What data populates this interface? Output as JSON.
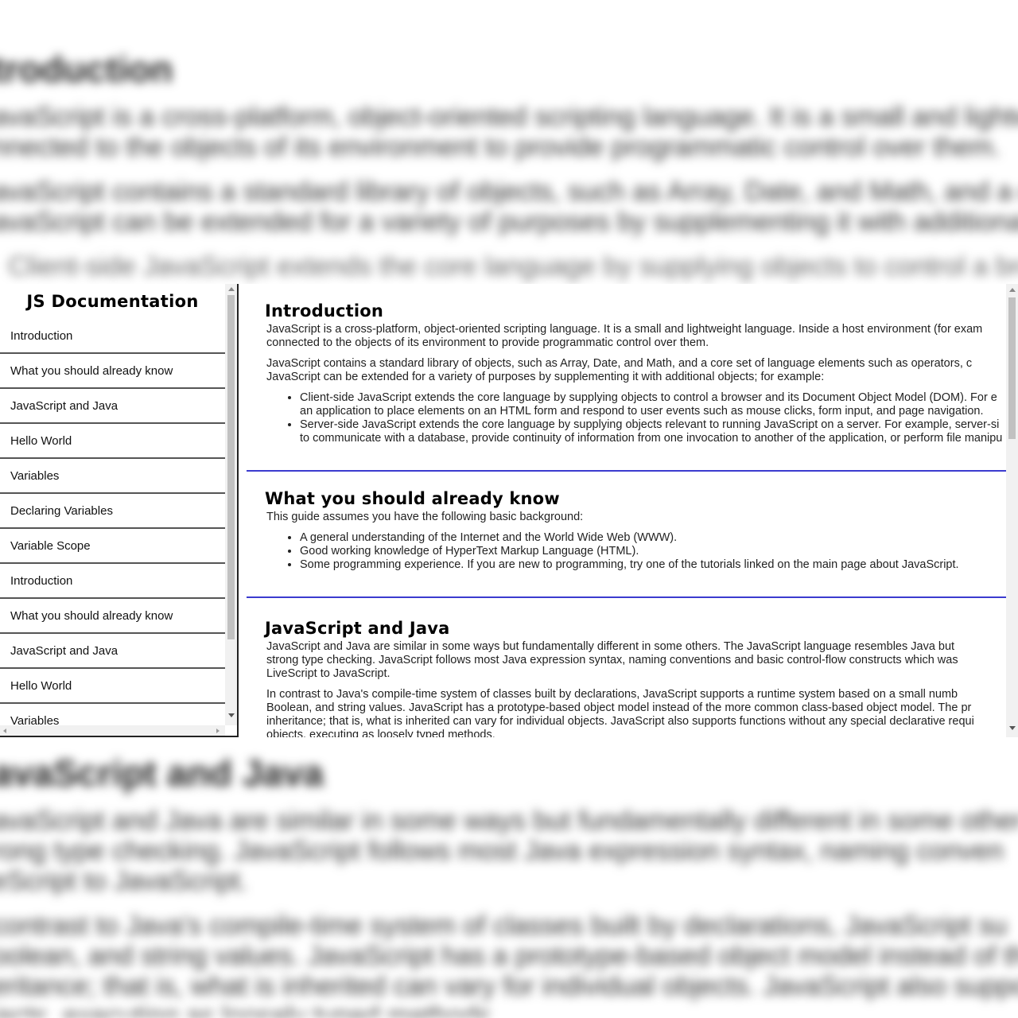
{
  "background": {
    "top": {
      "heading": "troduction",
      "p1_l1": "avaScript is a cross-platform, object-oriented scripting language. It is a small and lightwe",
      "p1_l2": "nnected to the objects of its environment to provide programmatic control over them.",
      "p2_l1": "avaScript contains a standard library of objects, such as Array, Date, and Math, and a c",
      "p2_l2": "avaScript can be extended for a variety of purposes by supplementing it with additional o",
      "li1": "Client-side JavaScript extends the core language by supplying objects to control a bro"
    },
    "bottom": {
      "heading": "avaScript and Java",
      "p1_l1": "avaScript and Java are similar in some ways but fundamentally different in some other",
      "p1_l2": "rong type checking. JavaScript follows most Java expression syntax, naming conven",
      "p1_l3": "eScript to JavaScript.",
      "p2_l1": "contrast to Java's compile-time system of classes built by declarations, JavaScript su",
      "p2_l2": "oolean, and string values. JavaScript has a prototype-based object model instead of th",
      "p2_l3": "eritance; that is, what is inherited can vary for individual objects. JavaScript also suppo",
      "p2_l4": "jects, executing as loosely typed methods."
    }
  },
  "sidebar": {
    "title": "JS Documentation",
    "items": [
      {
        "label": "Introduction"
      },
      {
        "label": "What you should already know"
      },
      {
        "label": "JavaScript and Java"
      },
      {
        "label": "Hello World"
      },
      {
        "label": "Variables"
      },
      {
        "label": "Declaring Variables"
      },
      {
        "label": "Variable Scope"
      },
      {
        "label": "Introduction"
      },
      {
        "label": "What you should already know"
      },
      {
        "label": "JavaScript and Java"
      },
      {
        "label": "Hello World"
      },
      {
        "label": "Variables"
      }
    ]
  },
  "main": {
    "intro": {
      "title": "Introduction",
      "p1_l1": "JavaScript is a cross-platform, object-oriented scripting language. It is a small and lightweight language. Inside a host environment (for exam",
      "p1_l2": "connected to the objects of its environment to provide programmatic control over them.",
      "p2_l1": "JavaScript contains a standard library of objects, such as Array, Date, and Math, and a core set of language elements such as operators, c",
      "p2_l2": "JavaScript can be extended for a variety of purposes by supplementing it with additional objects; for example:",
      "li1_l1": "Client-side JavaScript extends the core language by supplying objects to control a browser and its Document Object Model (DOM). For e",
      "li1_l2": "an application to place elements on an HTML form and respond to user events such as mouse clicks, form input, and page navigation.",
      "li2_l1": "Server-side JavaScript extends the core language by supplying objects relevant to running JavaScript on a server. For example, server-si",
      "li2_l2": "to communicate with a database, provide continuity of information from one invocation to another of the application, or perform file manipu"
    },
    "know": {
      "title": "What you should already know",
      "p1": "This guide assumes you have the following basic background:",
      "li1": "A general understanding of the Internet and the World Wide Web (WWW).",
      "li2": "Good working knowledge of HyperText Markup Language (HTML).",
      "li3": "Some programming experience. If you are new to programming, try one of the tutorials linked on the main page about JavaScript."
    },
    "java": {
      "title": "JavaScript and Java",
      "p1_l1": "JavaScript and Java are similar in some ways but fundamentally different in some others. The JavaScript language resembles Java but",
      "p1_l2": "strong type checking. JavaScript follows most Java expression syntax, naming conventions and basic control-flow constructs which was",
      "p1_l3": "LiveScript to JavaScript.",
      "p2_l1": "In contrast to Java's compile-time system of classes built by declarations, JavaScript supports a runtime system based on a small numb",
      "p2_l2": "Boolean, and string values. JavaScript has a prototype-based object model instead of the more common class-based object model. The pr",
      "p2_l3": "inheritance; that is, what is inherited can vary for individual objects. JavaScript also supports functions without any special declarative requi",
      "p2_l4": "objects, executing as loosely typed methods."
    }
  },
  "colors": {
    "divider": "#3b3bcf",
    "nav_border": "#555555"
  },
  "icons": {
    "scroll_up": "triangle-up-icon",
    "scroll_down": "triangle-down-icon",
    "scroll_left": "triangle-left-icon",
    "scroll_right": "triangle-right-icon"
  }
}
